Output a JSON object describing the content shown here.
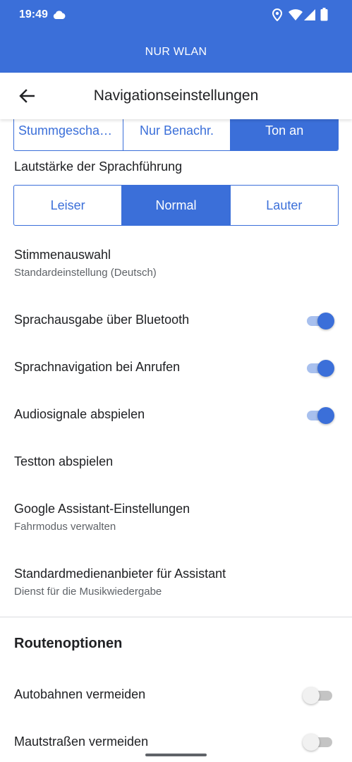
{
  "status_bar": {
    "time": "19:49",
    "icons": [
      "cloud-icon",
      "location-icon",
      "wifi-icon",
      "signal-icon",
      "battery-icon"
    ]
  },
  "banner": {
    "text": "NUR WLAN"
  },
  "app_bar": {
    "title": "Navigationseinstellungen",
    "back_icon": "arrow-back-icon"
  },
  "voice_mode": {
    "options": [
      "Stummgescha…",
      "Nur Benachr.",
      "Ton an"
    ],
    "selected": "Ton an"
  },
  "volume": {
    "label": "Lautstärke der Sprachführung",
    "options": [
      "Leiser",
      "Normal",
      "Lauter"
    ],
    "selected": "Normal"
  },
  "settings": [
    {
      "title": "Stimmenauswahl",
      "subtitle": "Standardeinstellung (Deutsch)"
    },
    {
      "title": "Sprachausgabe über Bluetooth",
      "toggle": true
    },
    {
      "title": "Sprachnavigation bei Anrufen",
      "toggle": true
    },
    {
      "title": "Audiosignale abspielen",
      "toggle": true
    },
    {
      "title": "Testton abspielen"
    },
    {
      "title": "Google Assistant-Einstellungen",
      "subtitle": "Fahrmodus verwalten"
    },
    {
      "title": "Standardmedienanbieter für Assistant",
      "subtitle": "Dienst für die Musikwiedergabe"
    }
  ],
  "route_options": {
    "heading": "Routenoptionen",
    "items": [
      {
        "title": "Autobahnen vermeiden",
        "toggle": false
      },
      {
        "title": "Mautstraßen vermeiden",
        "toggle": false
      }
    ]
  },
  "colors": {
    "accent": "#3b6fd9",
    "toggle_track_on": "#a8c0ee",
    "text_primary": "#202124",
    "text_secondary": "#5f6368"
  }
}
